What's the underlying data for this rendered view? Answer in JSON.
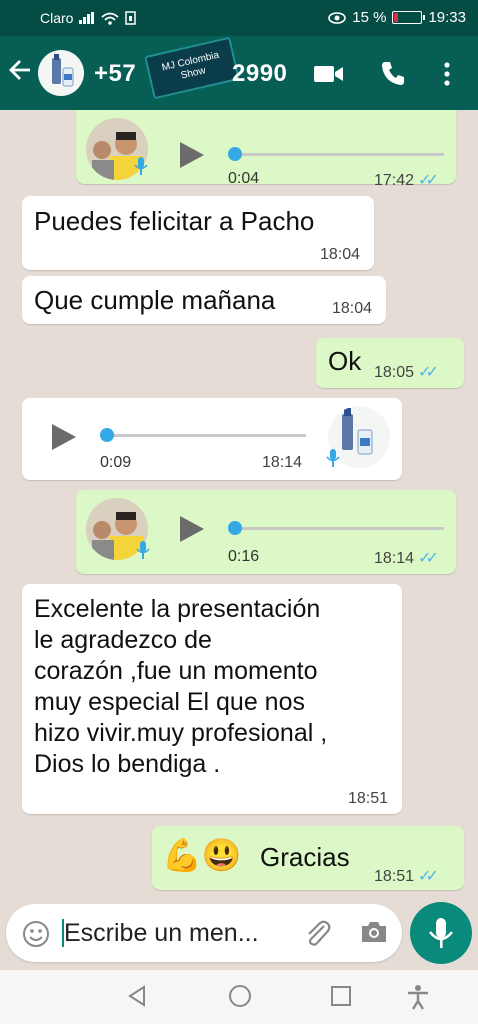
{
  "status_bar": {
    "carrier": "Claro",
    "battery_percent": "15 %",
    "battery_level": 0.15,
    "time": "19:33",
    "battery_color": "#dd3344"
  },
  "header": {
    "contact_prefix": "+57",
    "contact_suffix": "2990",
    "watermark_line1": "MJ Colombia",
    "watermark_line2": "Show",
    "bg_color": "#075e54"
  },
  "messages": [
    {
      "type": "voice",
      "direction": "outgoing",
      "duration": "0:04",
      "time": "17:42",
      "ticks": "✓✓"
    },
    {
      "type": "text",
      "direction": "incoming",
      "text": "Puedes felicitar a Pacho",
      "time": "18:04"
    },
    {
      "type": "text",
      "direction": "incoming",
      "text": "Que cumple mañana",
      "time": "18:04"
    },
    {
      "type": "text",
      "direction": "outgoing",
      "text": "Ok",
      "time": "18:05",
      "ticks": "✓✓"
    },
    {
      "type": "voice",
      "direction": "incoming",
      "duration": "0:09",
      "time": "18:14"
    },
    {
      "type": "voice",
      "direction": "outgoing",
      "duration": "0:16",
      "time": "18:14",
      "ticks": "✓✓"
    },
    {
      "type": "text",
      "direction": "incoming",
      "lines": [
        "Excelente la presentación",
        "le agradezco de",
        "corazón ,fue un momento",
        "muy especial El que nos",
        "hizo vivir.muy profesional ,",
        "Dios lo bendiga ."
      ],
      "time": "18:51"
    },
    {
      "type": "text",
      "direction": "outgoing",
      "text": "Gracias",
      "emoji": "💪😃",
      "time": "18:51",
      "ticks": "✓✓"
    }
  ],
  "input": {
    "placeholder": "Escribe un men..."
  },
  "icons": [
    "back-arrow-icon",
    "video-call-icon",
    "phone-call-icon",
    "more-options-icon",
    "emoji-icon",
    "attach-icon",
    "camera-icon",
    "mic-icon",
    "nav-back-icon",
    "nav-home-icon",
    "nav-recents-icon",
    "accessibility-icon"
  ],
  "colors": {
    "outgoing_bubble": "#dcf8c6",
    "incoming_bubble": "#ffffff",
    "read_ticks": "#4fb6ec",
    "accent": "#0a8a7a"
  }
}
